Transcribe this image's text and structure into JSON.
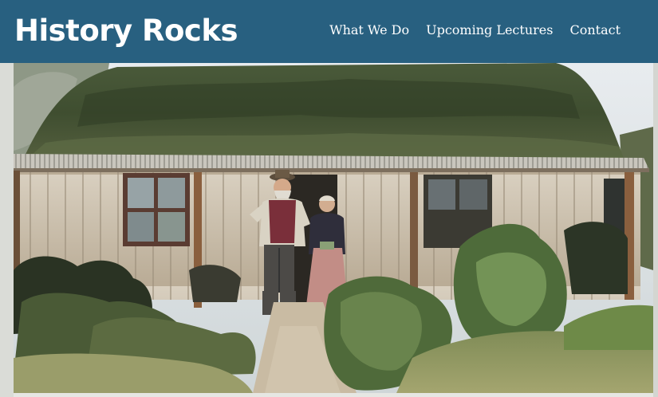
{
  "header": {
    "brand": "History Rocks",
    "nav": [
      {
        "label": "What We Do"
      },
      {
        "label": "Upcoming Lectures"
      },
      {
        "label": "Contact"
      }
    ]
  },
  "colors": {
    "header_bg": "#286080",
    "header_text": "#ffffff"
  },
  "hero": {
    "image": "colorized-photo-cottage-couple"
  }
}
